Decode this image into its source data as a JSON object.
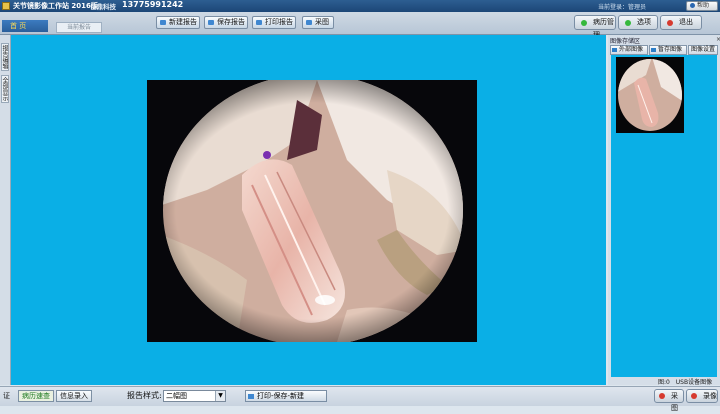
{
  "titlebar": {
    "app_title": "关节镜影像工作站 2016版",
    "company": "巨鼎科技",
    "phone": "13775991242",
    "login_info": "当前登录：管理员",
    "help_label": "帮助"
  },
  "toolbar": {
    "home_tab": "首 页",
    "report_tab": "当前报告",
    "buttons": [
      "新建报告",
      "保存报告",
      "打印报告",
      "采图"
    ],
    "right_buttons": [
      "病历管理",
      "选项",
      "退出"
    ]
  },
  "sidebar": {
    "tabs": [
      "报告编辑",
      "全部显示"
    ]
  },
  "storage_panel": {
    "title": "图像存储区",
    "close_icon": "×",
    "buttons": [
      "外部图像",
      "暂存图像",
      "图像设置"
    ],
    "image_count": "图:0",
    "usb_label": "USB设备图像"
  },
  "statusbar": {
    "left_text": "证",
    "case_search": "病历速查",
    "info_entry": "信息录入",
    "report_style_label": "报告样式:",
    "report_style_value": "二幅图",
    "print_button": "打印-保存-新建",
    "capture_button": "采图",
    "record_button": "录像"
  },
  "colors": {
    "view_background": "#0aafe6",
    "title_bar": "#1c4677",
    "active_status": "#1d7a21"
  }
}
